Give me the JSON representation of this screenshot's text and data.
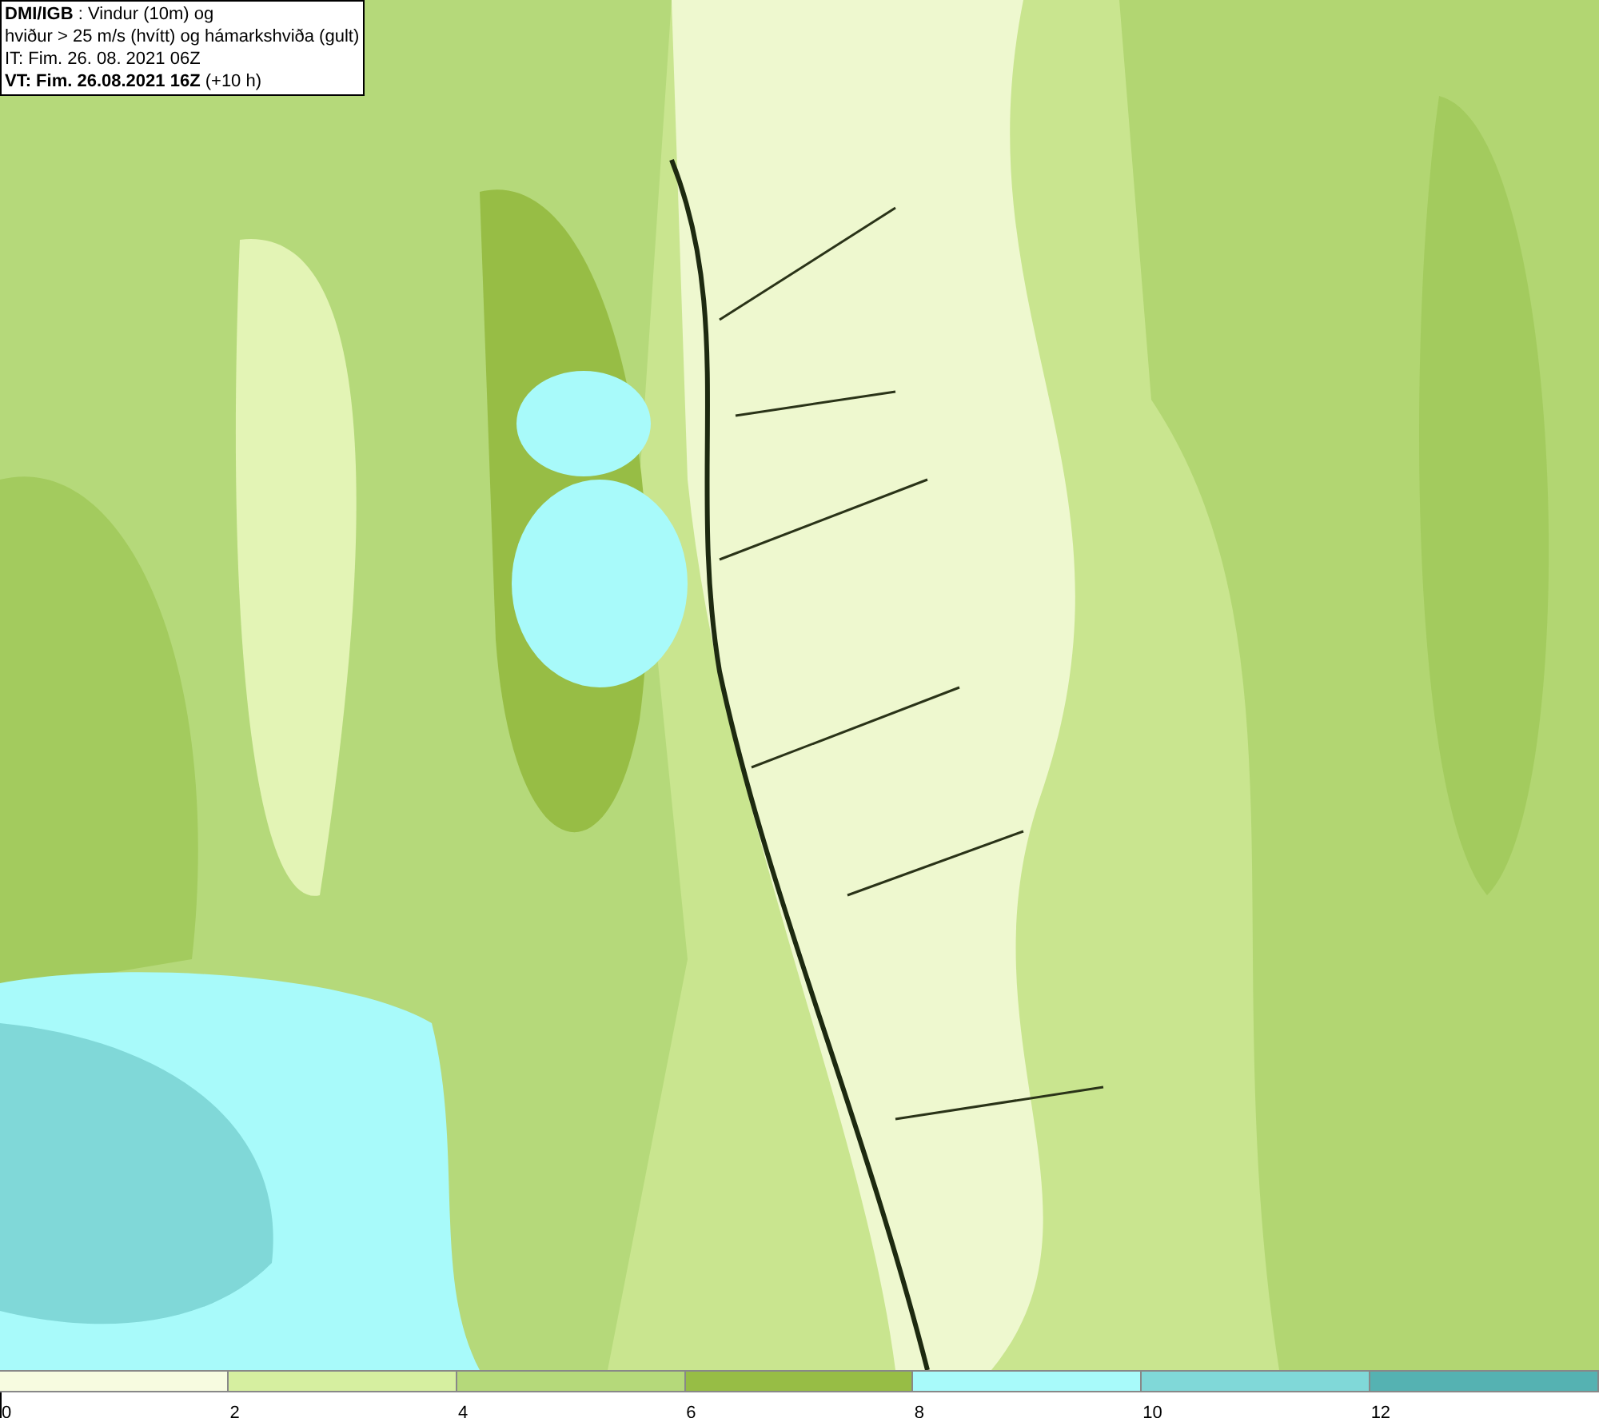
{
  "info_box": {
    "lines": [
      "**DMI/IGB** : Vindur (10m) og",
      "hviður > 25 m/s (hvítt) og hámarkshviða (gult)",
      "IT: Fim. 26. 08. 2021 06Z",
      "**VT: Fim. 26.08.2021 16Z** (+10 h)"
    ]
  },
  "legend": {
    "segments": [
      {
        "label": "0",
        "color": "#f7fbe0"
      },
      {
        "label": "2",
        "color": "#d6efa0"
      },
      {
        "label": "4",
        "color": "#b5d97a"
      },
      {
        "label": "6",
        "color": "#97bd45"
      },
      {
        "label": "8",
        "color": "#a8fafa"
      },
      {
        "label": "10",
        "color": "#80d8d8"
      },
      {
        "label": "12",
        "color": "#55b2b2"
      }
    ]
  }
}
